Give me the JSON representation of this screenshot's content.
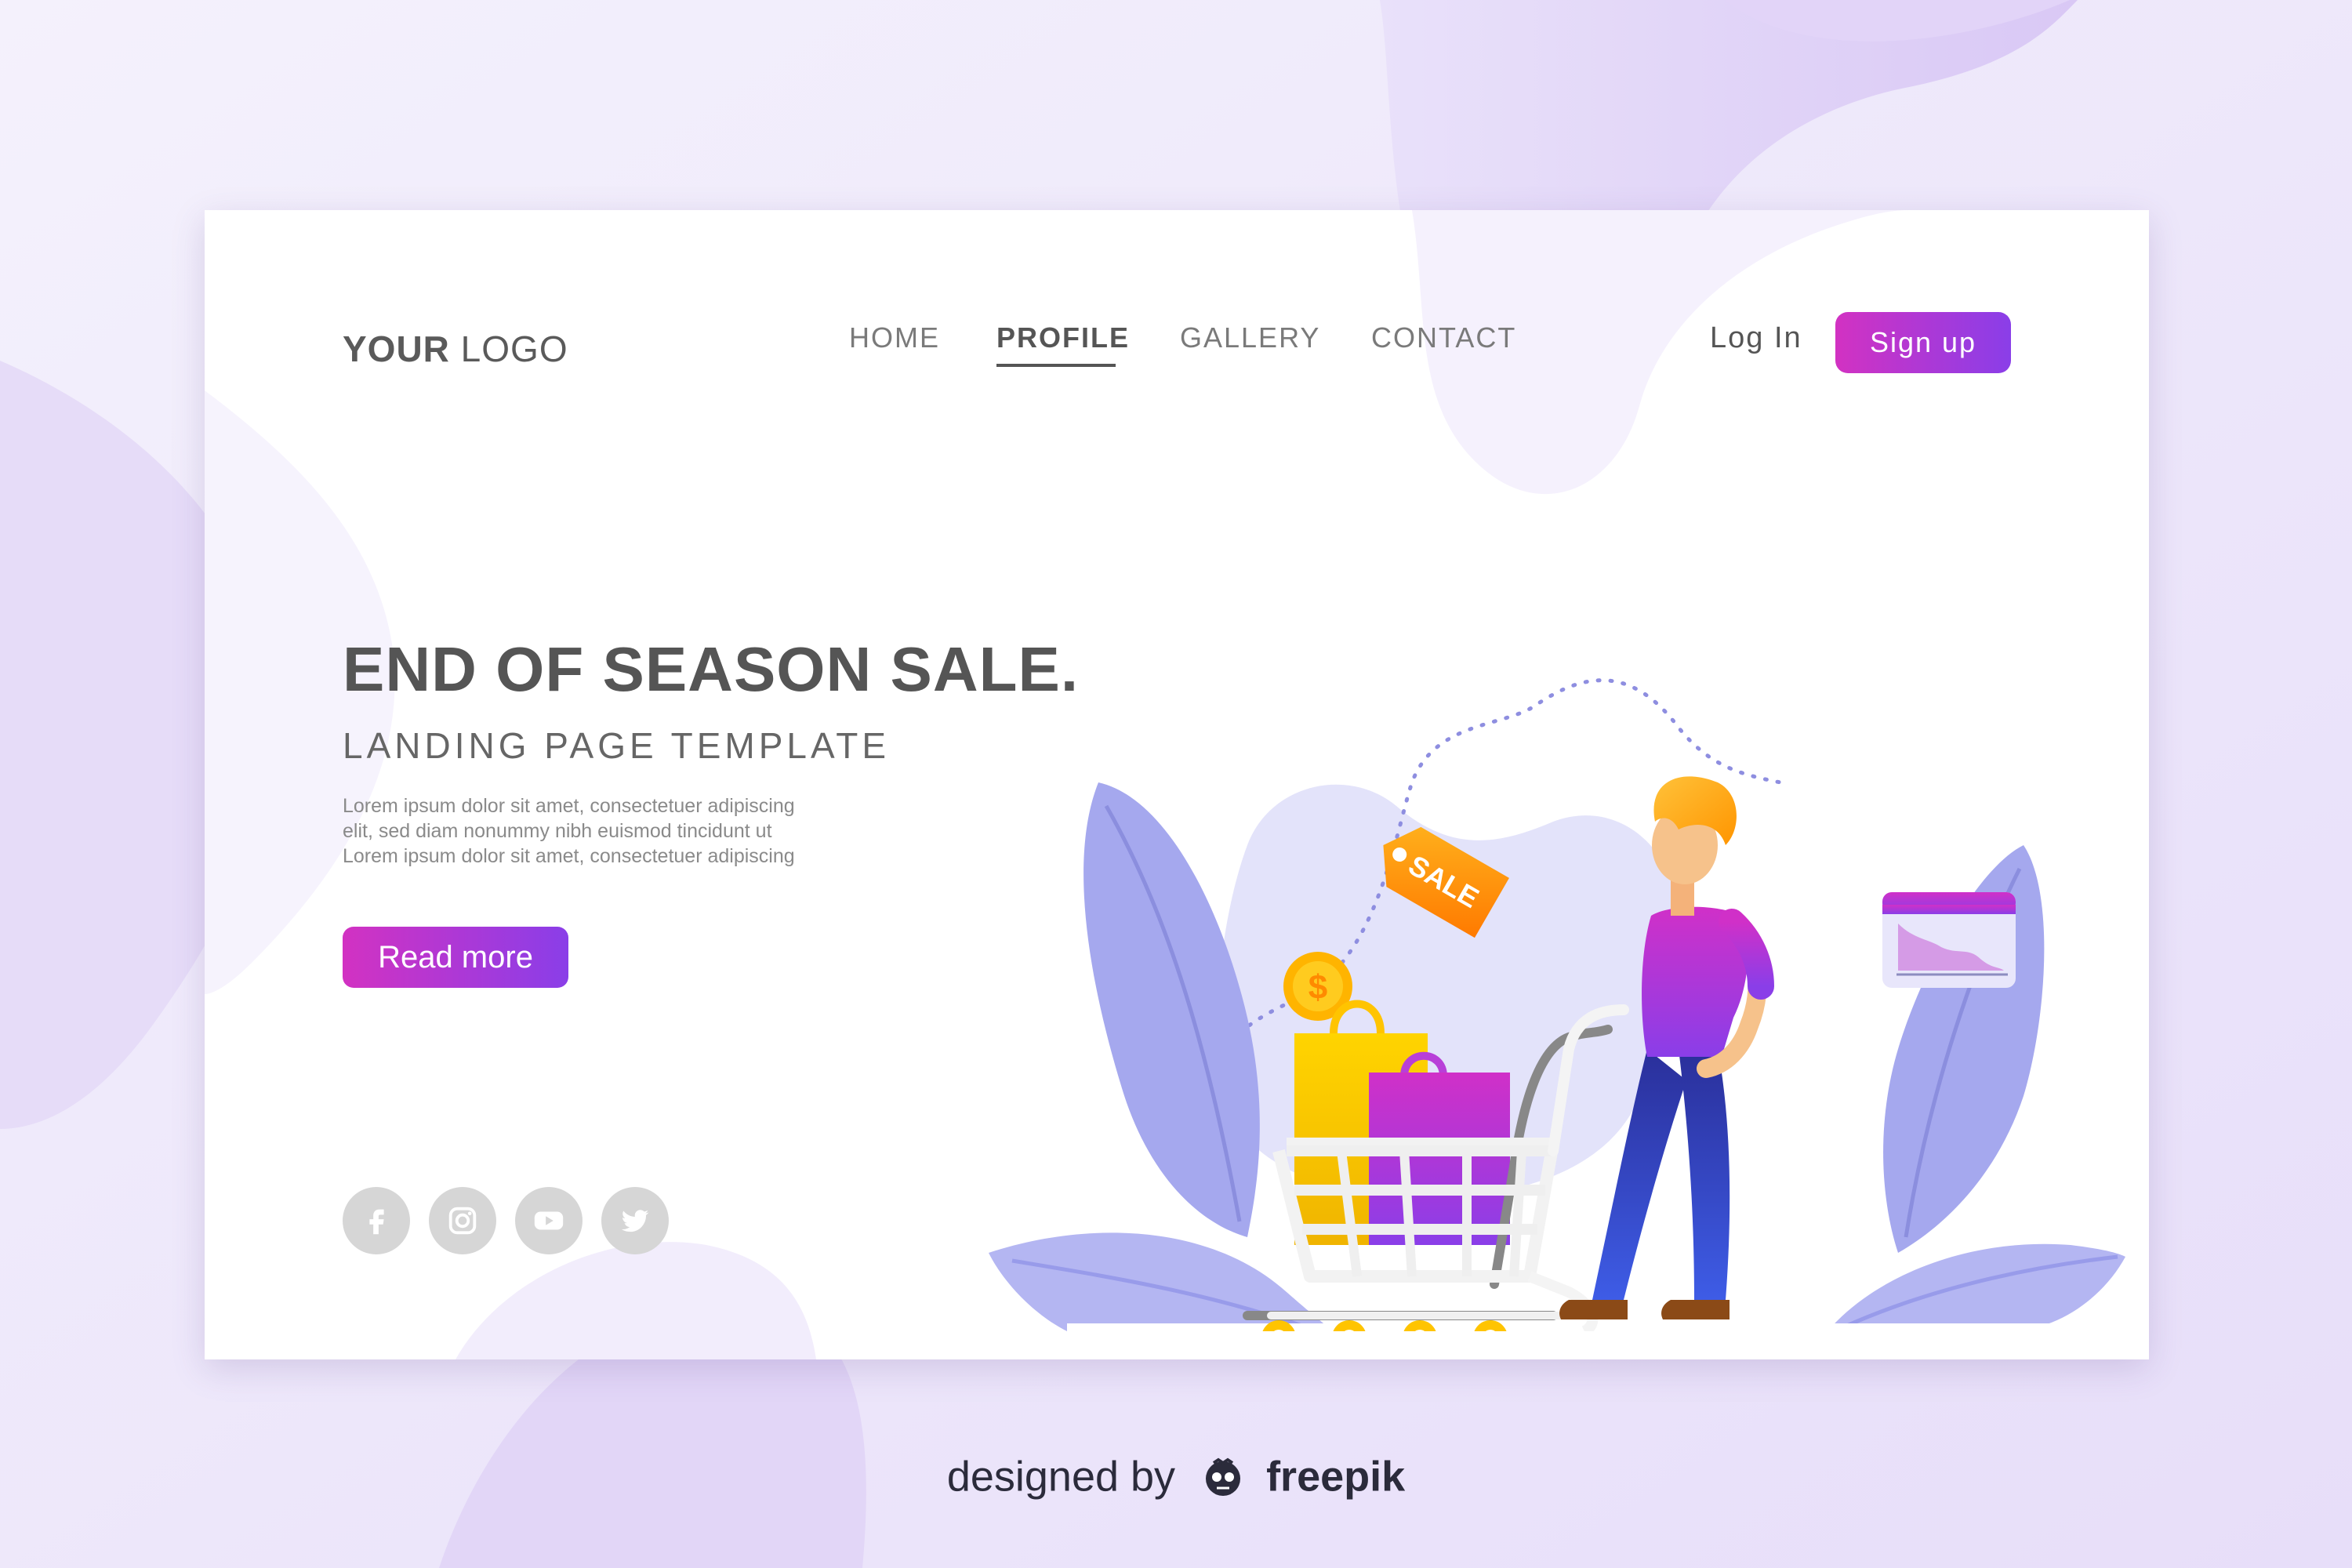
{
  "header": {
    "logo_bold": "YOUR",
    "logo_light": " LOGO",
    "nav": [
      {
        "label": "HOME"
      },
      {
        "label": "PROFILE"
      },
      {
        "label": "GALLERY"
      },
      {
        "label": "CONTACT"
      }
    ],
    "active_nav": "PROFILE",
    "login_label": "Log In",
    "signup_label": "Sign up"
  },
  "hero": {
    "title": "END OF SEASON SALE.",
    "subtitle": "LANDING PAGE TEMPLATE",
    "body_lines": [
      "Lorem ipsum dolor sit amet, consectetuer adipiscing",
      "elit, sed diam nonummy nibh euismod tincidunt ut",
      "Lorem ipsum dolor sit amet, consectetuer adipiscing"
    ],
    "cta_label": "Read more"
  },
  "illustration": {
    "sale_tag_text": "SALE",
    "coin_symbol": "$"
  },
  "socials": [
    "facebook-icon",
    "instagram-icon",
    "youtube-icon",
    "twitter-icon"
  ],
  "footer": {
    "prefix": "designed by",
    "brand": "freepik"
  },
  "colors": {
    "accent_start": "#d232c2",
    "accent_end": "#8a3ee8",
    "background": "#f1edfb",
    "leaf": "#a5a8ee"
  }
}
